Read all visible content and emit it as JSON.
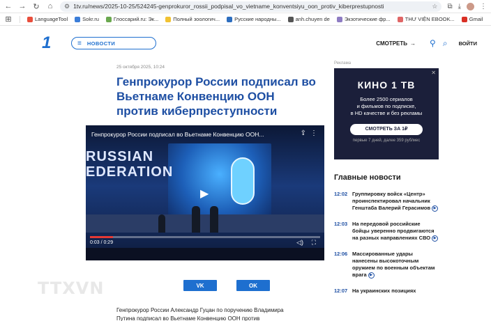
{
  "browser": {
    "url": "1tv.ru/news/2025-10-25/524245-genprokuror_rossii_podpisal_vo_vietname_konventsiyu_oon_protiv_kiberprestupnosti",
    "bookmarks": [
      "LanguageTool",
      "Sokr.ru",
      "Глоссарий.ru: Эк...",
      "Полный зоологич...",
      "Русские народны...",
      "anh.chuyen de",
      "Экзотические фр...",
      "THƯ VIỆN EBOOK...",
      "Gmail"
    ],
    "bookmark_colors": [
      "#e94e3c",
      "#3b7dd8",
      "#6aa84f",
      "#f1c232",
      "#2d6ebf",
      "#555555",
      "#8e7cc3",
      "#e06666",
      "#d93025"
    ]
  },
  "header": {
    "logo": "1",
    "menu_label": "НОВОСТИ",
    "watch_label": "СМОТРЕТЬ",
    "login_label": "ВОЙТИ"
  },
  "article": {
    "date": "25 октября 2025, 10:24",
    "headline": "Генпрокурор России подписал во Вьетнаме Конвенцию ООН против киберпреступности",
    "video": {
      "title": "Генпрокурор России подписал во Вьетнаме Конвенцию ООН...",
      "overlay_text": "RUSSIAN\nEDERATION",
      "time": "0:03 / 0:29",
      "progress": 0.1
    },
    "social": [
      "VK",
      "OK"
    ],
    "watermark": "TTXVN",
    "lead": "Генпрокурор России Александр Гуцан по поручению Владимира Путина подписал во Вьетнаме Конвенцию ООН против"
  },
  "sidebar": {
    "ad_label": "Реклама",
    "ad": {
      "logo": "КИНО 1 ТВ",
      "text_line1": "Более 2500 сериалов",
      "text_line2": "и фильмов по подписке,",
      "text_line3": "в HD качестве и без рекламы",
      "cta": "СМОТРЕТЬ ЗА 1₽",
      "fine": "первые 7 дней, далее 359 руб/мес"
    },
    "top_news_title": "Главные новости",
    "news": [
      {
        "time": "12:02",
        "text": "Группировку войск «Центр» проинспектировал начальник Генштаба Валерий Герасимов",
        "video": true
      },
      {
        "time": "12:03",
        "text": "На передовой российские бойцы уверенно продвигаются на разных направлениях СВО",
        "video": true
      },
      {
        "time": "12:06",
        "text": "Массированные удары нанесены высокоточным оружием по военным объектам врага",
        "video": true
      },
      {
        "time": "12:07",
        "text": "На украинских позициях",
        "video": false
      }
    ]
  }
}
